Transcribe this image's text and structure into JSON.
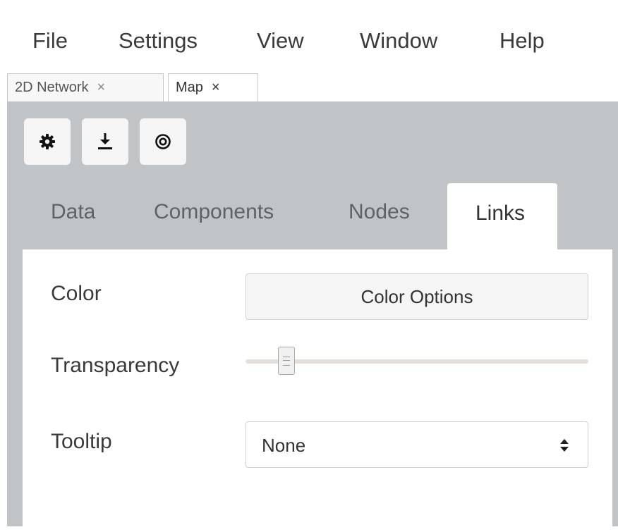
{
  "menu": {
    "file": "File",
    "settings": "Settings",
    "view": "View",
    "window": "Window",
    "help": "Help"
  },
  "doc_tabs": [
    {
      "label": "2D Network",
      "close": "×",
      "active": false
    },
    {
      "label": "Map",
      "close": "×",
      "active": true
    }
  ],
  "toolbar": {
    "icons": [
      "gear-icon",
      "download-icon",
      "target-icon"
    ]
  },
  "section_tabs": {
    "data": "Data",
    "components": "Components",
    "nodes": "Nodes",
    "links": "Links",
    "active": "Links"
  },
  "links_panel": {
    "color_label": "Color",
    "color_button": "Color Options",
    "transparency_label": "Transparency",
    "transparency_value": 0.1,
    "tooltip_label": "Tooltip",
    "tooltip_value": "None"
  },
  "colors": {
    "panel_gray": "#c0c4c6",
    "active_bg": "#ffffff",
    "button_bg": "#f5f5f5"
  }
}
